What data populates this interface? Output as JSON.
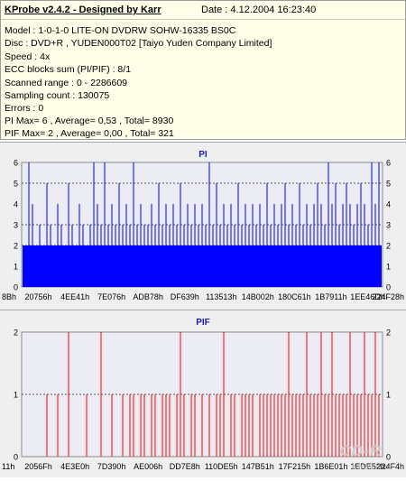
{
  "header": {
    "title": "KProbe v2.4.2 - Designed by Karr",
    "date": "Date : 4.12.2004 16:23:40"
  },
  "info_lines": [
    "Model : 1-0-1-0 LITE-ON DVDRW SOHW-16335 BS0C",
    "Disc : DVD+R , YUDEN000T02 [Taiyo Yuden Company Limited]",
    "Speed : 4x",
    "ECC blocks sum (PI/PIF) : 8/1",
    "Scanned range : 0 - 2286609",
    "Sampling count : 130075",
    "Errors : 0",
    "PI Max= 6 , Average= 0,53 , Total= 8930",
    "PIF Max= 2 , Average= 0,00 , Total= 321"
  ],
  "colors": {
    "pi": "#0000ff",
    "pif": "#ff0000",
    "plot_bg": "#ececf5",
    "panel_bg": "#efefef"
  },
  "chart_data": [
    {
      "type": "bar",
      "title": "PI",
      "ylim": [
        0,
        6
      ],
      "y_ticks": [
        "0",
        "1",
        "2",
        "3",
        "4",
        "5",
        "6"
      ],
      "x_ticks": [
        "8Bh",
        "20756h",
        "4EE41h",
        "7E076h",
        "ADB78h",
        "DF639h",
        "113513h",
        "14B002h",
        "180C61h",
        "1B7911h",
        "1EE46Dh",
        "224F28h"
      ],
      "dashed_grid_y": [
        2,
        3,
        5
      ],
      "baseline_fill": 2,
      "series": [
        {
          "name": "PI",
          "spikes": [
            [
              0.02,
              6
            ],
            [
              0.03,
              4
            ],
            [
              0.05,
              3
            ],
            [
              0.07,
              5
            ],
            [
              0.08,
              3
            ],
            [
              0.1,
              4
            ],
            [
              0.11,
              3
            ],
            [
              0.13,
              5
            ],
            [
              0.14,
              3
            ],
            [
              0.16,
              4
            ],
            [
              0.17,
              3
            ],
            [
              0.19,
              3
            ],
            [
              0.2,
              6
            ],
            [
              0.21,
              4
            ],
            [
              0.22,
              3
            ],
            [
              0.23,
              6
            ],
            [
              0.24,
              3
            ],
            [
              0.25,
              4
            ],
            [
              0.26,
              3
            ],
            [
              0.27,
              5
            ],
            [
              0.28,
              3
            ],
            [
              0.29,
              4
            ],
            [
              0.3,
              3
            ],
            [
              0.31,
              6
            ],
            [
              0.32,
              3
            ],
            [
              0.33,
              4
            ],
            [
              0.34,
              3
            ],
            [
              0.35,
              3
            ],
            [
              0.36,
              4
            ],
            [
              0.37,
              3
            ],
            [
              0.38,
              5
            ],
            [
              0.39,
              3
            ],
            [
              0.4,
              4
            ],
            [
              0.41,
              3
            ],
            [
              0.42,
              4
            ],
            [
              0.43,
              3
            ],
            [
              0.44,
              5
            ],
            [
              0.45,
              3
            ],
            [
              0.46,
              4
            ],
            [
              0.47,
              3
            ],
            [
              0.48,
              4
            ],
            [
              0.49,
              3
            ],
            [
              0.5,
              4
            ],
            [
              0.51,
              3
            ],
            [
              0.52,
              6
            ],
            [
              0.53,
              3
            ],
            [
              0.54,
              5
            ],
            [
              0.55,
              3
            ],
            [
              0.56,
              4
            ],
            [
              0.57,
              3
            ],
            [
              0.58,
              4
            ],
            [
              0.59,
              3
            ],
            [
              0.6,
              5
            ],
            [
              0.61,
              3
            ],
            [
              0.62,
              4
            ],
            [
              0.63,
              3
            ],
            [
              0.64,
              4
            ],
            [
              0.65,
              3
            ],
            [
              0.66,
              4
            ],
            [
              0.67,
              3
            ],
            [
              0.68,
              5
            ],
            [
              0.69,
              3
            ],
            [
              0.7,
              4
            ],
            [
              0.71,
              3
            ],
            [
              0.72,
              4
            ],
            [
              0.73,
              5
            ],
            [
              0.74,
              3
            ],
            [
              0.75,
              4
            ],
            [
              0.76,
              3
            ],
            [
              0.77,
              5
            ],
            [
              0.78,
              3
            ],
            [
              0.79,
              4
            ],
            [
              0.8,
              3
            ],
            [
              0.81,
              4
            ],
            [
              0.82,
              5
            ],
            [
              0.83,
              4
            ],
            [
              0.84,
              3
            ],
            [
              0.85,
              6
            ],
            [
              0.86,
              4
            ],
            [
              0.87,
              5
            ],
            [
              0.88,
              3
            ],
            [
              0.89,
              4
            ],
            [
              0.9,
              5
            ],
            [
              0.91,
              4
            ],
            [
              0.92,
              3
            ],
            [
              0.93,
              4
            ],
            [
              0.94,
              5
            ],
            [
              0.95,
              4
            ],
            [
              0.96,
              3
            ],
            [
              0.97,
              6
            ],
            [
              0.98,
              4
            ],
            [
              0.99,
              6
            ]
          ]
        }
      ]
    },
    {
      "type": "bar",
      "title": "PIF",
      "ylim": [
        0,
        2
      ],
      "y_ticks": [
        "0",
        "1",
        "2"
      ],
      "x_ticks": [
        "11h",
        "2056Fh",
        "4E3E0h",
        "7D390h",
        "AE006h",
        "DD7E8h",
        "110DE5h",
        "147B51h",
        "17F215h",
        "1B6E01h",
        "1EDE52h",
        "224F4h"
      ],
      "dashed_grid_y": [
        1
      ],
      "series": [
        {
          "name": "PIF",
          "spikes": [
            [
              0.07,
              1
            ],
            [
              0.1,
              1
            ],
            [
              0.13,
              2
            ],
            [
              0.18,
              1
            ],
            [
              0.22,
              2
            ],
            [
              0.25,
              1
            ],
            [
              0.28,
              1
            ],
            [
              0.3,
              1
            ],
            [
              0.31,
              1
            ],
            [
              0.33,
              1
            ],
            [
              0.34,
              1
            ],
            [
              0.36,
              1
            ],
            [
              0.37,
              1
            ],
            [
              0.39,
              1
            ],
            [
              0.4,
              1
            ],
            [
              0.41,
              1
            ],
            [
              0.43,
              1
            ],
            [
              0.44,
              2
            ],
            [
              0.45,
              1
            ],
            [
              0.47,
              1
            ],
            [
              0.48,
              1
            ],
            [
              0.5,
              1
            ],
            [
              0.52,
              1
            ],
            [
              0.54,
              1
            ],
            [
              0.55,
              1
            ],
            [
              0.56,
              2
            ],
            [
              0.58,
              1
            ],
            [
              0.59,
              1
            ],
            [
              0.61,
              1
            ],
            [
              0.62,
              1
            ],
            [
              0.63,
              1
            ],
            [
              0.64,
              1
            ],
            [
              0.66,
              1
            ],
            [
              0.67,
              1
            ],
            [
              0.68,
              1
            ],
            [
              0.69,
              1
            ],
            [
              0.7,
              1
            ],
            [
              0.71,
              1
            ],
            [
              0.72,
              1
            ],
            [
              0.73,
              1
            ],
            [
              0.74,
              2
            ],
            [
              0.75,
              1
            ],
            [
              0.76,
              1
            ],
            [
              0.77,
              1
            ],
            [
              0.78,
              1
            ],
            [
              0.79,
              2
            ],
            [
              0.8,
              1
            ],
            [
              0.81,
              1
            ],
            [
              0.82,
              1
            ],
            [
              0.83,
              2
            ],
            [
              0.84,
              1
            ],
            [
              0.85,
              1
            ],
            [
              0.86,
              2
            ],
            [
              0.87,
              1
            ],
            [
              0.88,
              1
            ],
            [
              0.89,
              1
            ],
            [
              0.9,
              1
            ],
            [
              0.91,
              2
            ],
            [
              0.92,
              1
            ],
            [
              0.93,
              1
            ],
            [
              0.94,
              1
            ],
            [
              0.95,
              2
            ],
            [
              0.96,
              1
            ],
            [
              0.97,
              1
            ],
            [
              0.98,
              2
            ],
            [
              0.99,
              1
            ]
          ]
        }
      ]
    }
  ],
  "watermark": {
    "logo": "CD-R",
    "url": "www.cdr.cz"
  }
}
